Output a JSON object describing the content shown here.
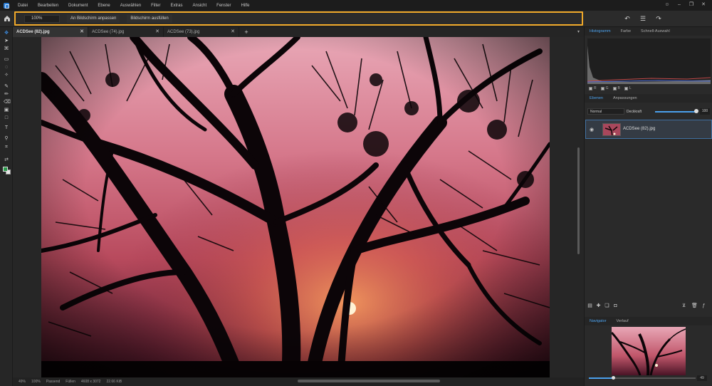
{
  "menu": {
    "items": [
      "Datei",
      "Bearbeiten",
      "Dokument",
      "Ebene",
      "Auswählen",
      "Filter",
      "Extras",
      "Ansicht",
      "Fenster",
      "Hilfe"
    ]
  },
  "options": {
    "zoom_value": "100%",
    "fit_screen_label": "An Bildschirm anpassen",
    "fill_screen_label": "Bildschirm ausfüllen"
  },
  "tabs": [
    {
      "label": "ACDSee (82).jpg"
    },
    {
      "label": "ACDSee (74).jpg"
    },
    {
      "label": "ACDSee (73).jpg"
    }
  ],
  "status": {
    "zoom": "49%",
    "zoom_preset": "100%",
    "fit": "Passend",
    "fill": "Füllen",
    "dimensions": "4608 x 3072",
    "file_size": "22.66 KiB"
  },
  "panels": {
    "top_tabs": [
      "Histogramm",
      "Farbe",
      "Schnell-Auswahl"
    ],
    "channels": [
      "R",
      "G",
      "B",
      "L"
    ],
    "layer_tabs": [
      "Ebenen",
      "Anpassungen"
    ],
    "blend_mode": "Normal",
    "opacity_label": "Deckkraft",
    "opacity_value": "100",
    "layer_name": "ACDSee (82).jpg",
    "bottom_tabs": [
      "Navigator",
      "Verlauf"
    ],
    "navigator_value": "49"
  },
  "colors": {
    "accent": "#f0a92a",
    "selection": "#4da3ef",
    "foreground_swatch": "#2b9a4b",
    "background_swatch": "#e8e8e8"
  }
}
